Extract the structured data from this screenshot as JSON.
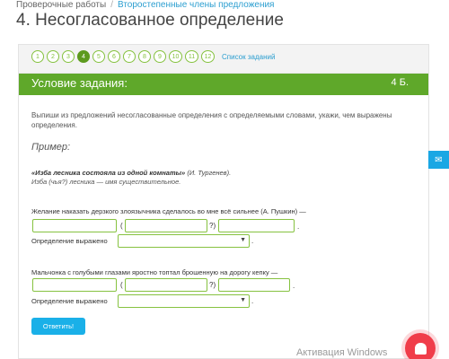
{
  "breadcrumb": {
    "root": "Проверочные работы",
    "separator": "/",
    "current": "Второстепенные члены предложения"
  },
  "page_title": "4. Несогласованное определение",
  "pager": {
    "pages": [
      "1",
      "2",
      "3",
      "4",
      "5",
      "6",
      "7",
      "8",
      "9",
      "10",
      "11",
      "12"
    ],
    "active": "4",
    "task_list_label": "Список заданий"
  },
  "task": {
    "header_title": "Условие задания:",
    "points": "4 Б.",
    "instruction": "Выпиши из предложений несогласованные определения с определяемыми словами, укажи, чем выражены определения.",
    "example_title": "Пример:",
    "example_sentence_bold": "«Изба лесника состояла из одной комнаты»",
    "example_sentence_author": " (И. Тургенев).",
    "example_answer": "Изба (чья?) лесника — имя существительное."
  },
  "questions": [
    {
      "sentence": "Желание наказать дерзкого злоязычника сделалось во мне всё сильнее (А. Пушкин) —",
      "open_paren": "(",
      "close_paren": "?)",
      "dot": ".",
      "definition_label": "Определение выражено",
      "select_value": "",
      "end_dot": "."
    },
    {
      "sentence": "Мальчонка с голубыми глазами яростно топтал брошенную на дорогу кепку —",
      "open_paren": "(",
      "close_paren": "?)",
      "dot": ".",
      "definition_label": "Определение выражено",
      "select_value": "",
      "end_dot": "."
    }
  ],
  "answer_button": "Ответить!",
  "watermark": "Активация Windows",
  "colors": {
    "header_green": "#5fa82a",
    "field_border": "#86c240",
    "button_blue": "#1ab0e8",
    "link_blue": "#2b9ed0",
    "notify_red": "#f03d4a"
  },
  "icons": {
    "side_mail": "mail-icon",
    "notify": "bell-icon",
    "select_chevron": "chevron-down-icon"
  }
}
